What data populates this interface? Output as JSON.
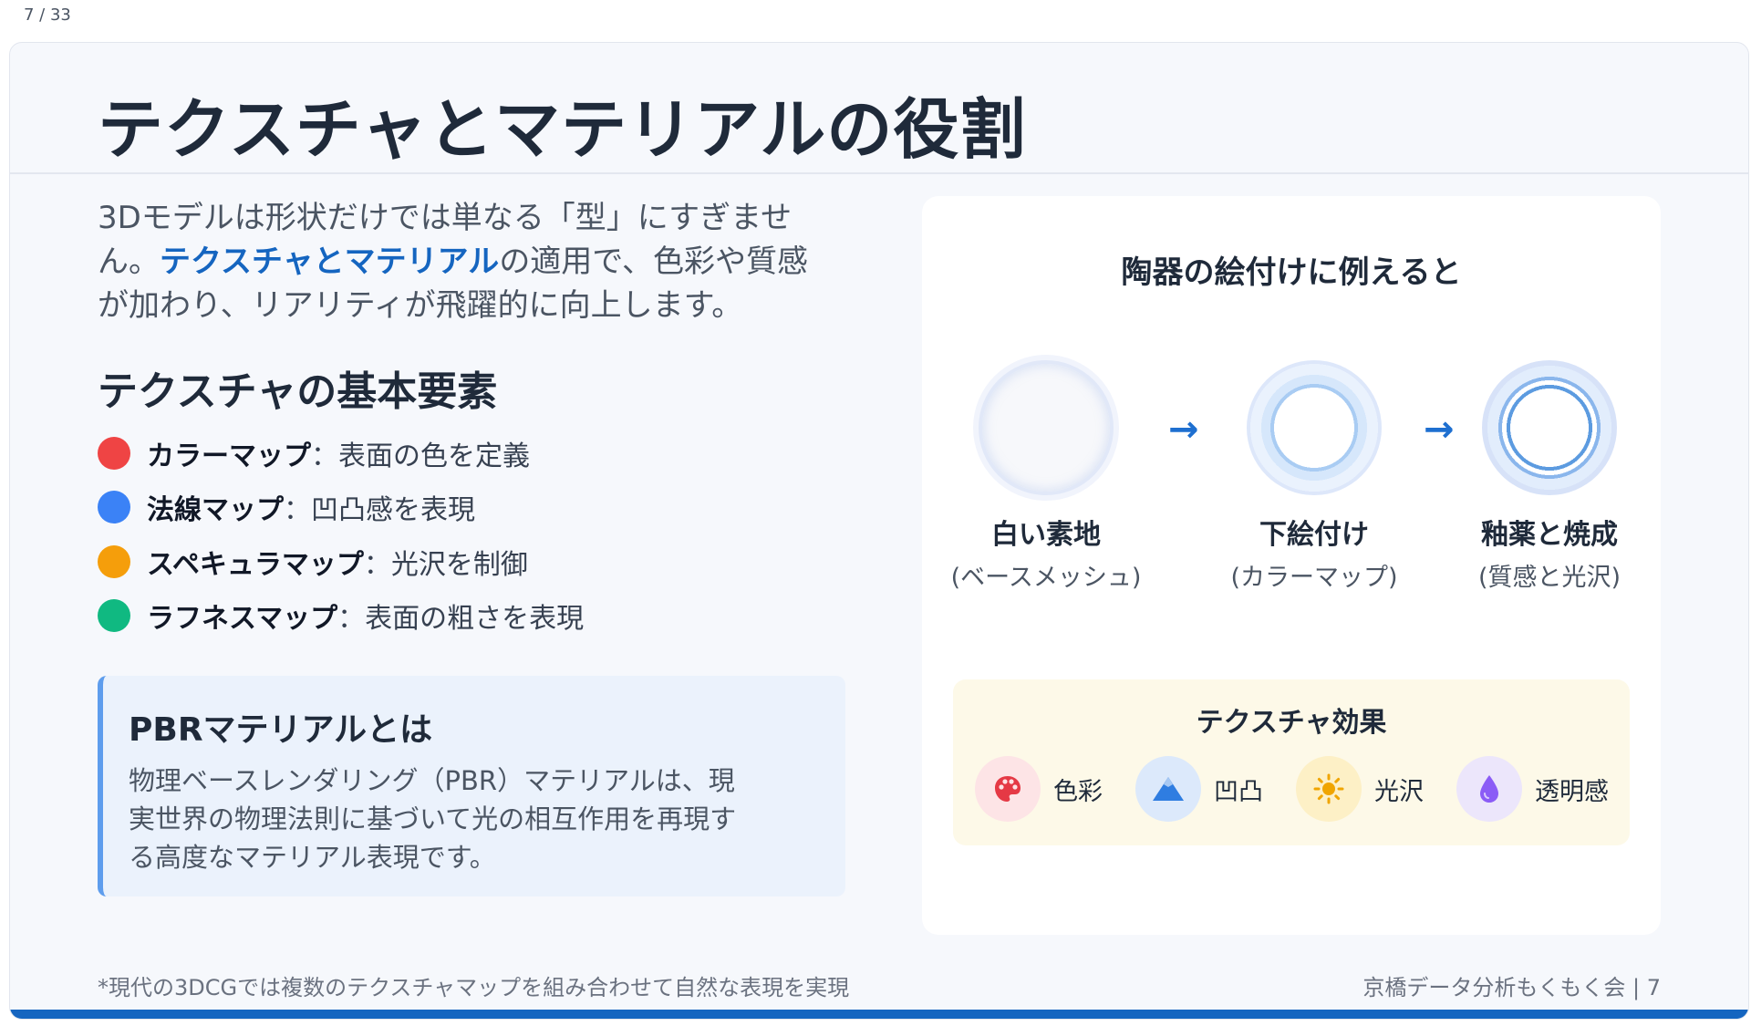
{
  "page_counter": "7 / 33",
  "slide": {
    "title": "テクスチャとマテリアルの役割",
    "intro": {
      "before": "3Dモデルは形状だけでは単なる「型」にすぎません。",
      "highlight": "テクスチャとマテリアル",
      "after": "の適用で、色彩や質感が加わり、リアリティが飛躍的に向上します。"
    },
    "section_title": "テクスチャの基本要素",
    "texture_items": [
      {
        "name": "カラーマップ",
        "sep": "：",
        "desc": "表面の色を定義",
        "color": "#ef4444"
      },
      {
        "name": "法線マップ",
        "sep": "：",
        "desc": "凹凸感を表現",
        "color": "#3b82f6"
      },
      {
        "name": "スペキュラマップ",
        "sep": "：",
        "desc": "光沢を制御",
        "color": "#f59e0b"
      },
      {
        "name": "ラフネスマップ",
        "sep": "：",
        "desc": "表面の粗さを表現",
        "color": "#10b981"
      }
    ],
    "pbr": {
      "title": "PBRマテリアルとは",
      "body": "物理ベースレンダリング（PBR）マテリアルは、現実世界の物理法則に基づいて光の相互作用を再現する高度なマテリアル表現です。"
    },
    "analogy": {
      "title": "陶器の絵付けに例えると",
      "stages": [
        {
          "label": "白い素地",
          "sub": "(ベースメッシュ)"
        },
        {
          "label": "下絵付け",
          "sub": "(カラーマップ)"
        },
        {
          "label": "釉薬と焼成",
          "sub": "(質感と光沢)"
        }
      ],
      "arrow": "→",
      "effects_title": "テクスチャ効果",
      "effects": [
        {
          "label": "色彩",
          "icon": "palette-icon",
          "bg": "#fde4e6",
          "color": "#e53945"
        },
        {
          "label": "凹凸",
          "icon": "mountain-icon",
          "bg": "#dce9fb",
          "color": "#2f7de1"
        },
        {
          "label": "光沢",
          "icon": "sun-icon",
          "bg": "#fdf0c6",
          "color": "#f0a500"
        },
        {
          "label": "透明感",
          "icon": "droplet-icon",
          "bg": "#ece6fb",
          "color": "#8b5cf6"
        }
      ]
    },
    "footnote": "*現代の3DCGでは複数のテクスチャマップを組み合わせて自然な表現を実現",
    "footer_right": "京橋データ分析もくもく会 | 7",
    "accent_color": "#1565c0"
  }
}
